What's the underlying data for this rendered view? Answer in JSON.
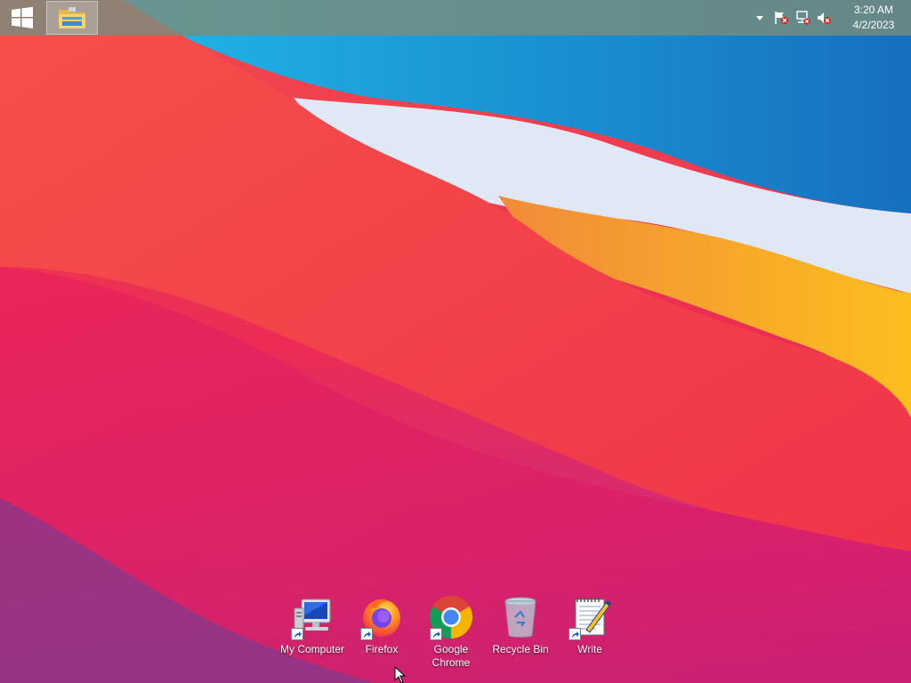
{
  "taskbar": {
    "start_icon": "windows-logo-icon",
    "pinned": [
      {
        "name": "file-explorer",
        "icon": "folder-icon"
      }
    ],
    "tray": {
      "icons": [
        "chevron-up-icon",
        "action-center-flag-icon",
        "network-icon",
        "volume-muted-icon"
      ]
    },
    "clock": {
      "time": "3:20 AM",
      "date": "4/2/2023"
    }
  },
  "desktop": {
    "icons": [
      {
        "label": "My Computer",
        "icon": "computer-icon",
        "shortcut": true
      },
      {
        "label": "Firefox",
        "icon": "firefox-icon",
        "shortcut": true
      },
      {
        "label": "Google Chrome",
        "icon": "chrome-icon",
        "shortcut": true
      },
      {
        "label": "Recycle Bin",
        "icon": "recycle-bin-icon",
        "shortcut": false
      },
      {
        "label": "Write",
        "icon": "write-icon",
        "shortcut": true
      }
    ]
  },
  "colors": {
    "taskbar": "#788c7d",
    "wallpaper_red": "#e8244a",
    "wallpaper_blue": "#1a8fd6",
    "wallpaper_orange": "#f7a01c"
  }
}
